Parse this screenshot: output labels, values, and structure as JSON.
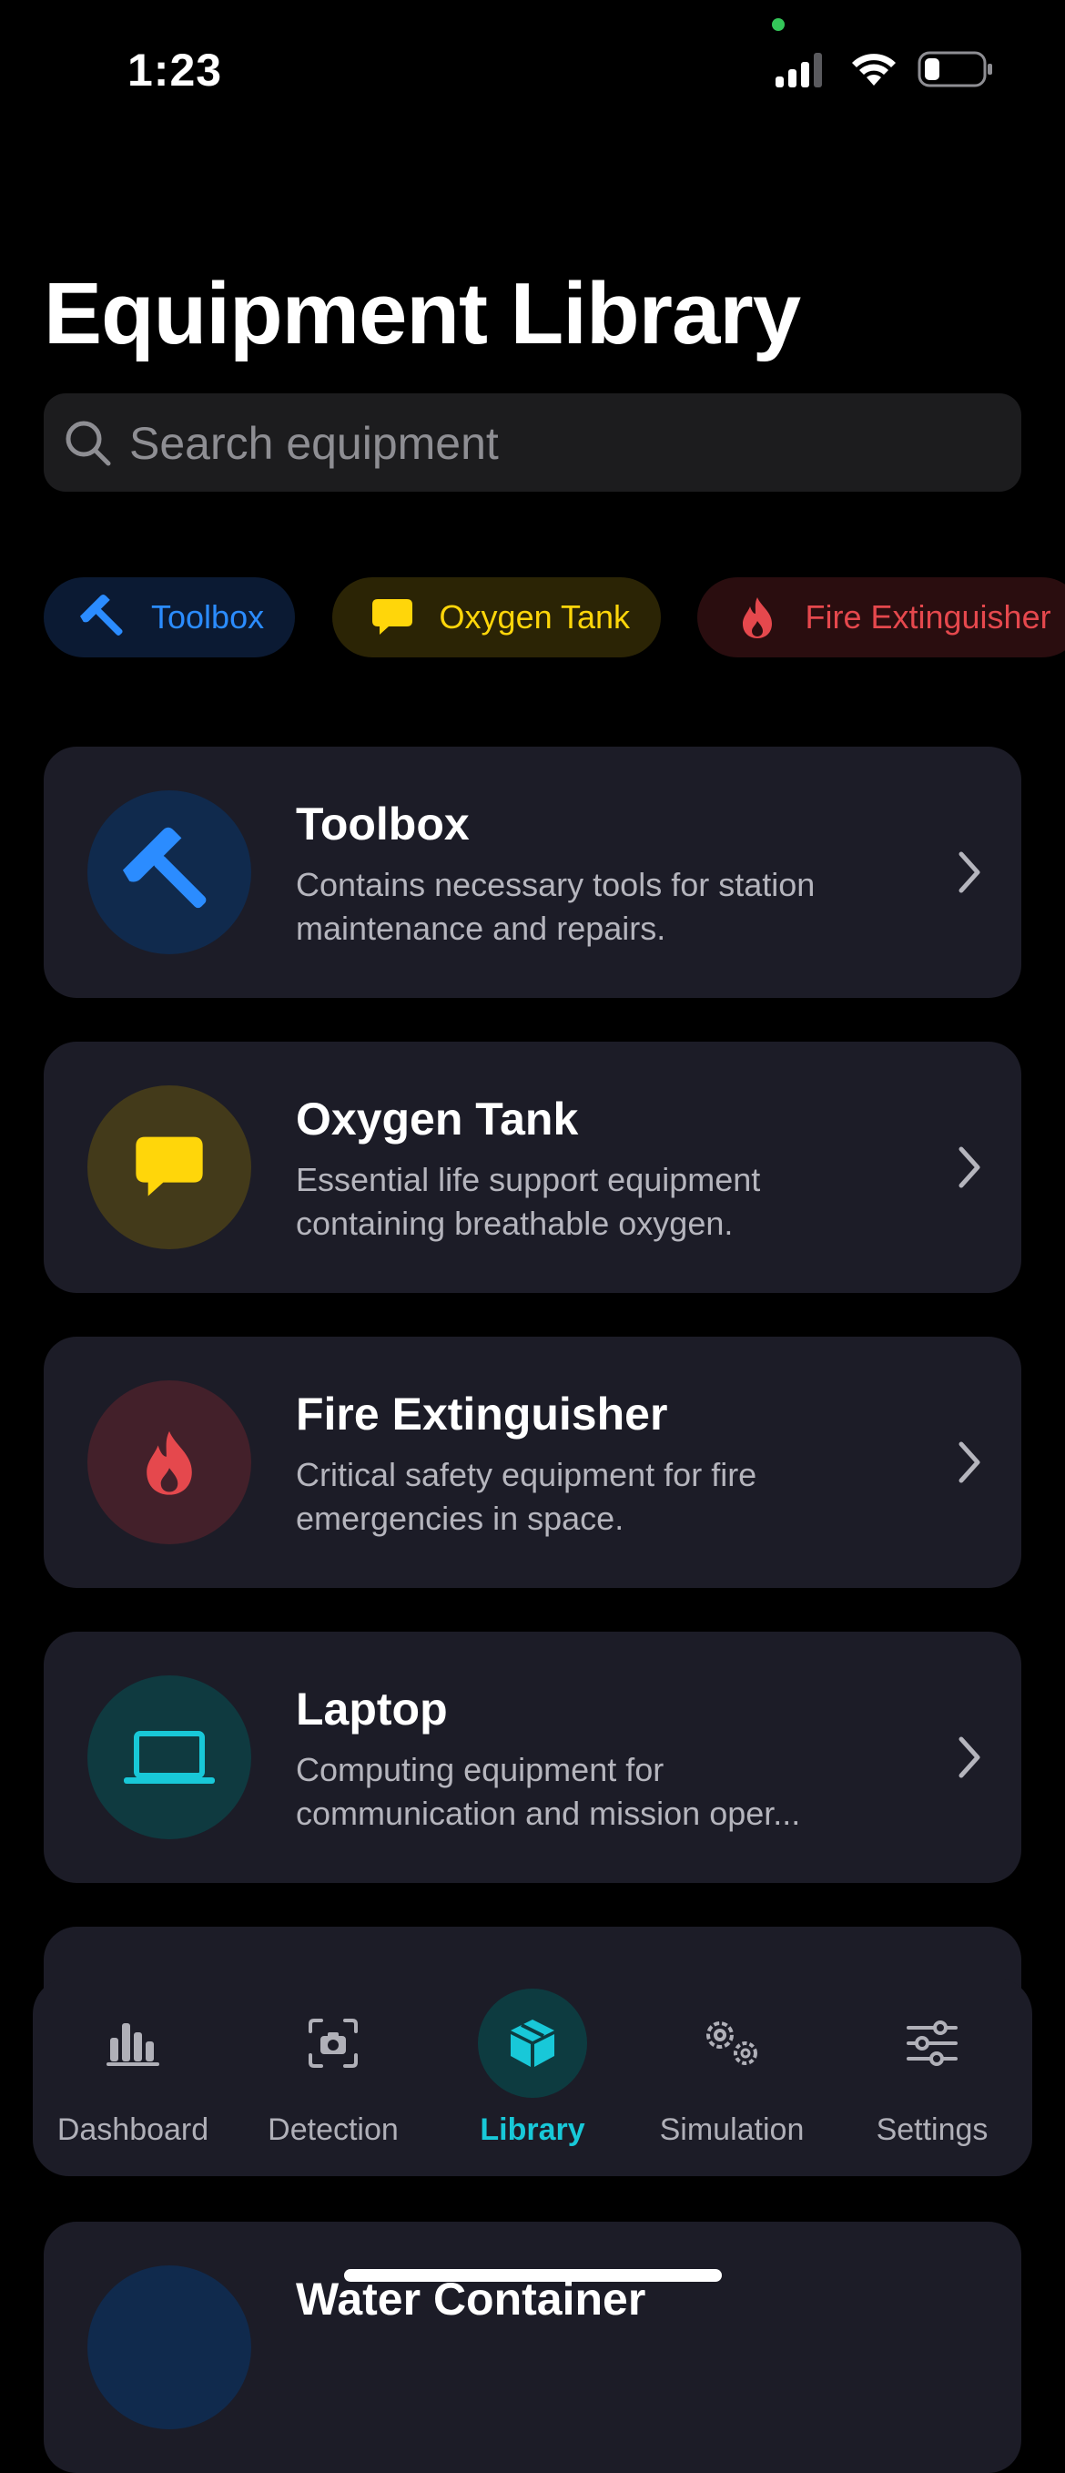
{
  "status_bar": {
    "time": "1:23"
  },
  "page_title": "Equipment Library",
  "search": {
    "placeholder": "Search equipment",
    "value": ""
  },
  "filter_chips": [
    {
      "label": "Toolbox",
      "icon": "hammer-icon",
      "color": "#2b8cff"
    },
    {
      "label": "Oxygen Tank",
      "icon": "speech-bubble-icon",
      "color": "#ffd60a"
    },
    {
      "label": "Fire Extinguisher",
      "icon": "flame-icon",
      "color": "#e5484d"
    }
  ],
  "equipment": [
    {
      "name": "Toolbox",
      "description": "Contains necessary tools for station maintenance and repairs.",
      "icon": "hammer-icon",
      "color": "#2b8cff"
    },
    {
      "name": "Oxygen Tank",
      "description": "Essential life support equipment containing breathable oxygen.",
      "icon": "speech-bubble-icon",
      "color": "#ffd60a"
    },
    {
      "name": "Fire Extinguisher",
      "description": "Critical safety equipment for fire emergencies in space.",
      "icon": "flame-icon",
      "color": "#e5484d"
    },
    {
      "name": "Laptop",
      "description": "Computing equipment for communication and mission oper...",
      "icon": "laptop-icon",
      "color": "#18c8d8"
    },
    {
      "name": "Water Container",
      "description": "",
      "icon": "water-icon",
      "color": "#2b8cff"
    }
  ],
  "tab_bar": {
    "active": "Library",
    "items": [
      {
        "label": "Dashboard",
        "icon": "bar-chart-icon"
      },
      {
        "label": "Detection",
        "icon": "camera-scan-icon"
      },
      {
        "label": "Library",
        "icon": "cube-icon"
      },
      {
        "label": "Simulation",
        "icon": "gears-icon"
      },
      {
        "label": "Settings",
        "icon": "sliders-icon"
      }
    ]
  },
  "colors": {
    "accent": "#18c8d8",
    "card_bg": "#1c1c27",
    "background": "#000000"
  }
}
